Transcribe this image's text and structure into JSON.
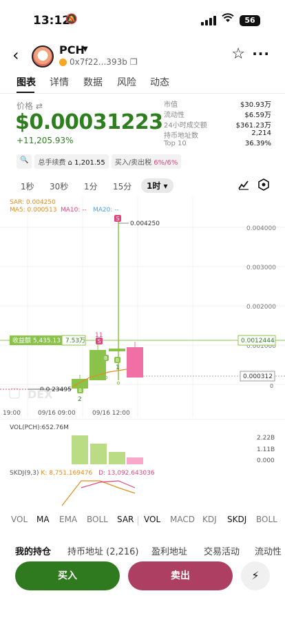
{
  "status": {
    "time": "13:12",
    "battery": "56"
  },
  "header": {
    "name": "PCH",
    "address": "0x7f22...393b"
  },
  "tabs": [
    "图表",
    "详情",
    "数据",
    "风险",
    "动态"
  ],
  "price": {
    "label": "价格",
    "value": "$0.00031223",
    "change": "+11,205.93%"
  },
  "stats": [
    {
      "k": "市值",
      "v": "$30.93万"
    },
    {
      "k": "流动性",
      "v": "$6.59万"
    },
    {
      "k": "24小时成交额",
      "v": "$361.23万"
    },
    {
      "k": "持币地址数",
      "v": "2,214"
    },
    {
      "k": "Top 10",
      "v": "36.39%"
    }
  ],
  "chips": {
    "fee_label": "总手续费",
    "fee_value": "1,201.55",
    "tax_label": "买入/卖出税",
    "tax_value": "6%/6%"
  },
  "intervals": [
    "1秒",
    "30秒",
    "1分",
    "15分",
    "1时"
  ],
  "chart": {
    "sar": "SAR: 0.004250",
    "ma5": "MA5: 0.000513",
    "ma10": "MA10: --",
    "ma20": "MA20: --",
    "y_ticks": [
      "0.004000",
      "0.003000",
      "0.002000",
      "0.001000"
    ],
    "high_label": "0.004250",
    "low_label": "0.0,23495",
    "pnl_label": "收益额 5,435.13",
    "pnl_pct": "7.53万",
    "line_price": "0.0012444",
    "current_price": "0.000312",
    "x_ticks": [
      "19:00",
      "09/16 09:00",
      "09/16 12:00"
    ],
    "watermark": "DEX",
    "marker_sell": "S",
    "marker_buy": "B",
    "marker_11": "11",
    "marker_1": "1",
    "marker_2": "2",
    "marker_0": "0"
  },
  "volume": {
    "label": "VOL(PCH):652.76M",
    "ticks": [
      "2.22B",
      "1.11B",
      "0.000"
    ]
  },
  "skdj": {
    "title": "SKDJ(9,3)",
    "k": "K: 8,751.169476",
    "d": "D: 13,092.643036"
  },
  "indicators_left": [
    "VOL",
    "MA",
    "EMA",
    "BOLL",
    "SAR"
  ],
  "indicators_right": [
    "VOL",
    "MACD",
    "KDJ",
    "SKDJ",
    "BOLL"
  ],
  "holding_tabs": [
    "我的持仓",
    "持币地址 (2,216)",
    "盈利地址",
    "交易活动",
    "流动性"
  ],
  "buttons": {
    "buy": "买入",
    "sell": "卖出"
  },
  "colors": {
    "up": "#2e7d1f",
    "down": "#e0457b",
    "accent_green": "#8bc34a",
    "sell_btn": "#ad3f63"
  }
}
